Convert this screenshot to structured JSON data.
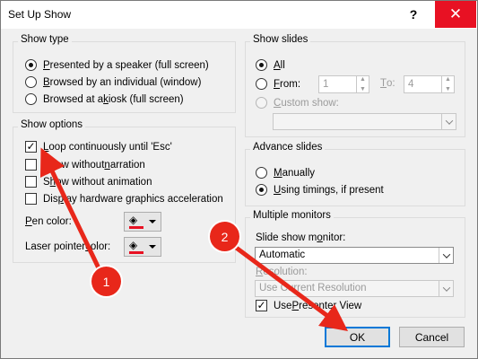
{
  "window": {
    "title": "Set Up Show",
    "help": "?",
    "close": "✕"
  },
  "show_type": {
    "title": "Show type",
    "options": [
      {
        "pre": "",
        "u": "P",
        "post": "resented by a speaker (full screen)",
        "selected": true
      },
      {
        "pre": "",
        "u": "B",
        "post": "rowsed by an individual (window)",
        "selected": false
      },
      {
        "pre": "Browsed at a ",
        "u": "k",
        "post": "iosk (full screen)",
        "selected": false
      }
    ]
  },
  "show_options": {
    "title": "Show options",
    "checks": [
      {
        "pre": "",
        "u": "L",
        "post": "oop continuously until 'Esc'",
        "checked": true
      },
      {
        "pre": "Show without ",
        "u": "n",
        "post": "arration",
        "checked": false
      },
      {
        "pre": "S",
        "u": "h",
        "post": "ow without animation",
        "checked": false
      },
      {
        "pre": "Dis",
        "u": "p",
        "post": "lay hardware graphics acceleration",
        "checked": false
      }
    ],
    "pen_color": {
      "pre": "",
      "u": "P",
      "post": "en color:"
    },
    "laser_color": {
      "pre": "Laser pointer ",
      "u": "c",
      "post": "olor:"
    },
    "color_accent": "#e81123"
  },
  "show_slides": {
    "title": "Show slides",
    "all": {
      "pre": "",
      "u": "A",
      "post": "ll",
      "selected": true
    },
    "from": {
      "pre": "",
      "u": "F",
      "post": "rom:",
      "selected": false,
      "value": "1"
    },
    "to": {
      "pre": "",
      "u": "T",
      "post": "o:",
      "value": "4"
    },
    "custom": {
      "pre": "",
      "u": "C",
      "post": "ustom show:",
      "value": ""
    }
  },
  "advance_slides": {
    "title": "Advance slides",
    "manual": {
      "pre": "",
      "u": "M",
      "post": "anually",
      "selected": false
    },
    "timings": {
      "pre": "",
      "u": "U",
      "post": "sing timings, if present",
      "selected": true
    }
  },
  "monitors": {
    "title": "Multiple monitors",
    "monitor_label": {
      "pre": "Slide show m",
      "u": "o",
      "post": "nitor:"
    },
    "monitor_value": "Automatic",
    "resolution_label": {
      "pre": "",
      "u": "R",
      "post": "esolution:"
    },
    "resolution_value": "Use Current Resolution",
    "presenter": {
      "pre": "Use ",
      "u": "P",
      "post": "resenter View",
      "checked": true
    }
  },
  "buttons": {
    "ok": "OK",
    "cancel": "Cancel"
  },
  "annotations": {
    "badge1": "1",
    "badge2": "2",
    "arrow_color": "#e8271a"
  }
}
